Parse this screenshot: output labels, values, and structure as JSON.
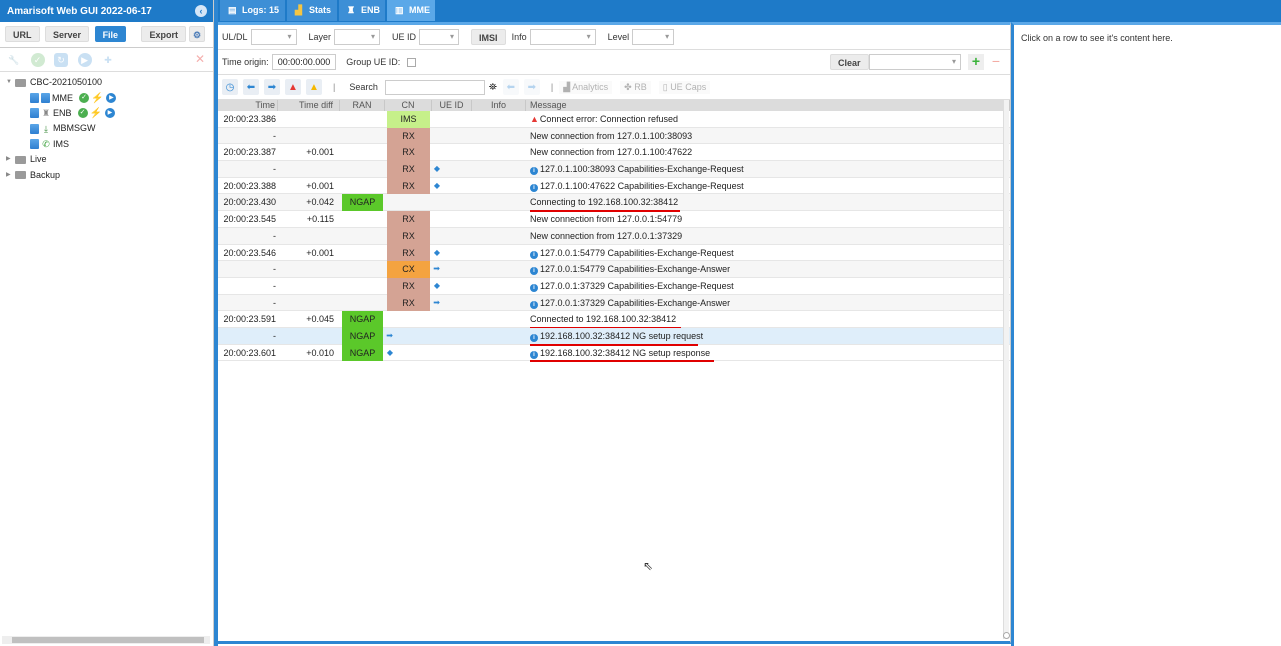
{
  "app": {
    "title": "Amarisoft Web GUI 2022-06-17"
  },
  "left_toolbar": {
    "url": "URL",
    "server": "Server",
    "file": "File",
    "export": "Export"
  },
  "tree": {
    "root": "CBC-2021050100",
    "children": [
      {
        "label": "MME",
        "status": [
          "ok",
          "bolt",
          "play"
        ]
      },
      {
        "label": "ENB",
        "status": [
          "ok",
          "bolt",
          "play"
        ]
      },
      {
        "label": "MBMSGW",
        "status": []
      },
      {
        "label": "IMS",
        "status": []
      }
    ],
    "folders": [
      "Live",
      "Backup"
    ]
  },
  "tabs": [
    {
      "label": "Logs: 15",
      "icon": "log-icon"
    },
    {
      "label": "Stats",
      "icon": "chart-icon"
    },
    {
      "label": "ENB",
      "icon": "antenna-icon"
    },
    {
      "label": "MME",
      "icon": "server-icon",
      "selected": true
    }
  ],
  "filters": {
    "uldl": "UL/DL",
    "layer": "Layer",
    "ueid": "UE ID",
    "imsi": "IMSI",
    "info": "Info",
    "level": "Level",
    "time_origin_label": "Time origin:",
    "time_origin_value": "00:00:00.000",
    "group_ue_label": "Group UE ID:",
    "clear": "Clear"
  },
  "toolbar": {
    "search_label": "Search",
    "analytics": "Analytics",
    "rb": "RB",
    "ue_caps": "UE Caps"
  },
  "columns": {
    "time": "Time",
    "tdiff": "Time diff",
    "ran": "RAN",
    "cn": "CN",
    "ueid": "UE ID",
    "info": "Info",
    "message": "Message"
  },
  "colors": {
    "ims": "#c6f08a",
    "rx": "#d4a394",
    "cx": "#f4a340",
    "ngap": "#5bc82a",
    "underline": "#e00000"
  },
  "rows": [
    {
      "time": "20:00:23.386",
      "tdiff": "",
      "ran": "",
      "cn": "IMS",
      "dir": "",
      "icon": "warn",
      "msg": "Connect error: Connection refused",
      "ul": 0
    },
    {
      "time": "-",
      "tdiff": "",
      "ran": "",
      "cn": "RX",
      "dir": "",
      "icon": "",
      "msg": "New connection from 127.0.1.100:38093",
      "ul": 0
    },
    {
      "time": "20:00:23.387",
      "tdiff": "+0.001",
      "ran": "",
      "cn": "RX",
      "dir": "",
      "icon": "",
      "msg": "New connection from 127.0.1.100:47622",
      "ul": 0
    },
    {
      "time": "-",
      "tdiff": "",
      "ran": "",
      "cn": "RX",
      "dir": "◆",
      "icon": "info",
      "msg": "127.0.1.100:38093 Capabilities-Exchange-Request",
      "ul": 0
    },
    {
      "time": "20:00:23.388",
      "tdiff": "+0.001",
      "ran": "",
      "cn": "RX",
      "dir": "◆",
      "icon": "info",
      "msg": "127.0.1.100:47622 Capabilities-Exchange-Request",
      "ul": 0
    },
    {
      "time": "20:00:23.430",
      "tdiff": "+0.042",
      "ran": "NGAP",
      "cn": "",
      "dir": "",
      "icon": "",
      "msg": "Connecting to 192.168.100.32:38412",
      "ul": 150
    },
    {
      "time": "20:00:23.545",
      "tdiff": "+0.115",
      "ran": "",
      "cn": "RX",
      "dir": "",
      "icon": "",
      "msg": "New connection from 127.0.0.1:54779",
      "ul": 0
    },
    {
      "time": "-",
      "tdiff": "",
      "ran": "",
      "cn": "RX",
      "dir": "",
      "icon": "",
      "msg": "New connection from 127.0.0.1:37329",
      "ul": 0
    },
    {
      "time": "20:00:23.546",
      "tdiff": "+0.001",
      "ran": "",
      "cn": "RX",
      "dir": "◆",
      "icon": "info",
      "msg": "127.0.0.1:54779 Capabilities-Exchange-Request",
      "ul": 0
    },
    {
      "time": "-",
      "tdiff": "",
      "ran": "",
      "cn": "CX",
      "dir": "➡",
      "icon": "info",
      "msg": "127.0.0.1:54779 Capabilities-Exchange-Answer",
      "ul": 0
    },
    {
      "time": "-",
      "tdiff": "",
      "ran": "",
      "cn": "RX",
      "dir": "◆",
      "icon": "info",
      "msg": "127.0.0.1:37329 Capabilities-Exchange-Request",
      "ul": 0
    },
    {
      "time": "-",
      "tdiff": "",
      "ran": "",
      "cn": "RX",
      "dir": "➡",
      "icon": "info",
      "msg": "127.0.0.1:37329 Capabilities-Exchange-Answer",
      "ul": 0
    },
    {
      "time": "20:00:23.591",
      "tdiff": "+0.045",
      "ran": "NGAP",
      "cn": "",
      "dir": "",
      "icon": "",
      "msg": "Connected to 192.168.100.32:38412",
      "ul": 151
    },
    {
      "time": "-",
      "tdiff": "",
      "ran": "NGAP",
      "cn": "",
      "dir": "➡",
      "icon": "info",
      "msg": "192.168.100.32:38412 NG setup request",
      "ul": 168,
      "hl": true
    },
    {
      "time": "20:00:23.601",
      "tdiff": "+0.010",
      "ran": "NGAP",
      "cn": "",
      "dir": "◆",
      "icon": "info",
      "msg": "192.168.100.32:38412 NG setup response",
      "ul": 184
    }
  ],
  "right_panel": {
    "hint": "Click on a row to see it's content here."
  }
}
